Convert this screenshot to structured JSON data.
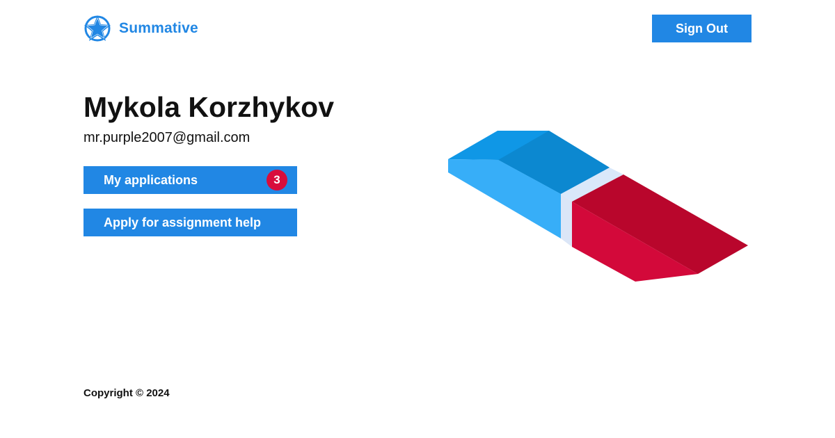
{
  "header": {
    "brand_name": "Summative",
    "logo_icon": "star-badge-icon",
    "sign_out_label": "Sign Out"
  },
  "profile": {
    "name": "Mykola Korzhykov",
    "email": "mr.purple2007@gmail.com"
  },
  "actions": {
    "my_applications_label": "My applications",
    "my_applications_count": "3",
    "apply_label": "Apply for assignment help"
  },
  "illustration": {
    "icon": "eraser-illustration"
  },
  "footer": {
    "copyright": "Copyright © 2024"
  },
  "colors": {
    "accent": "#2187e4",
    "badge": "#d80d3c",
    "eraser_blue": "#35aaf6",
    "eraser_red": "#c4062e"
  }
}
